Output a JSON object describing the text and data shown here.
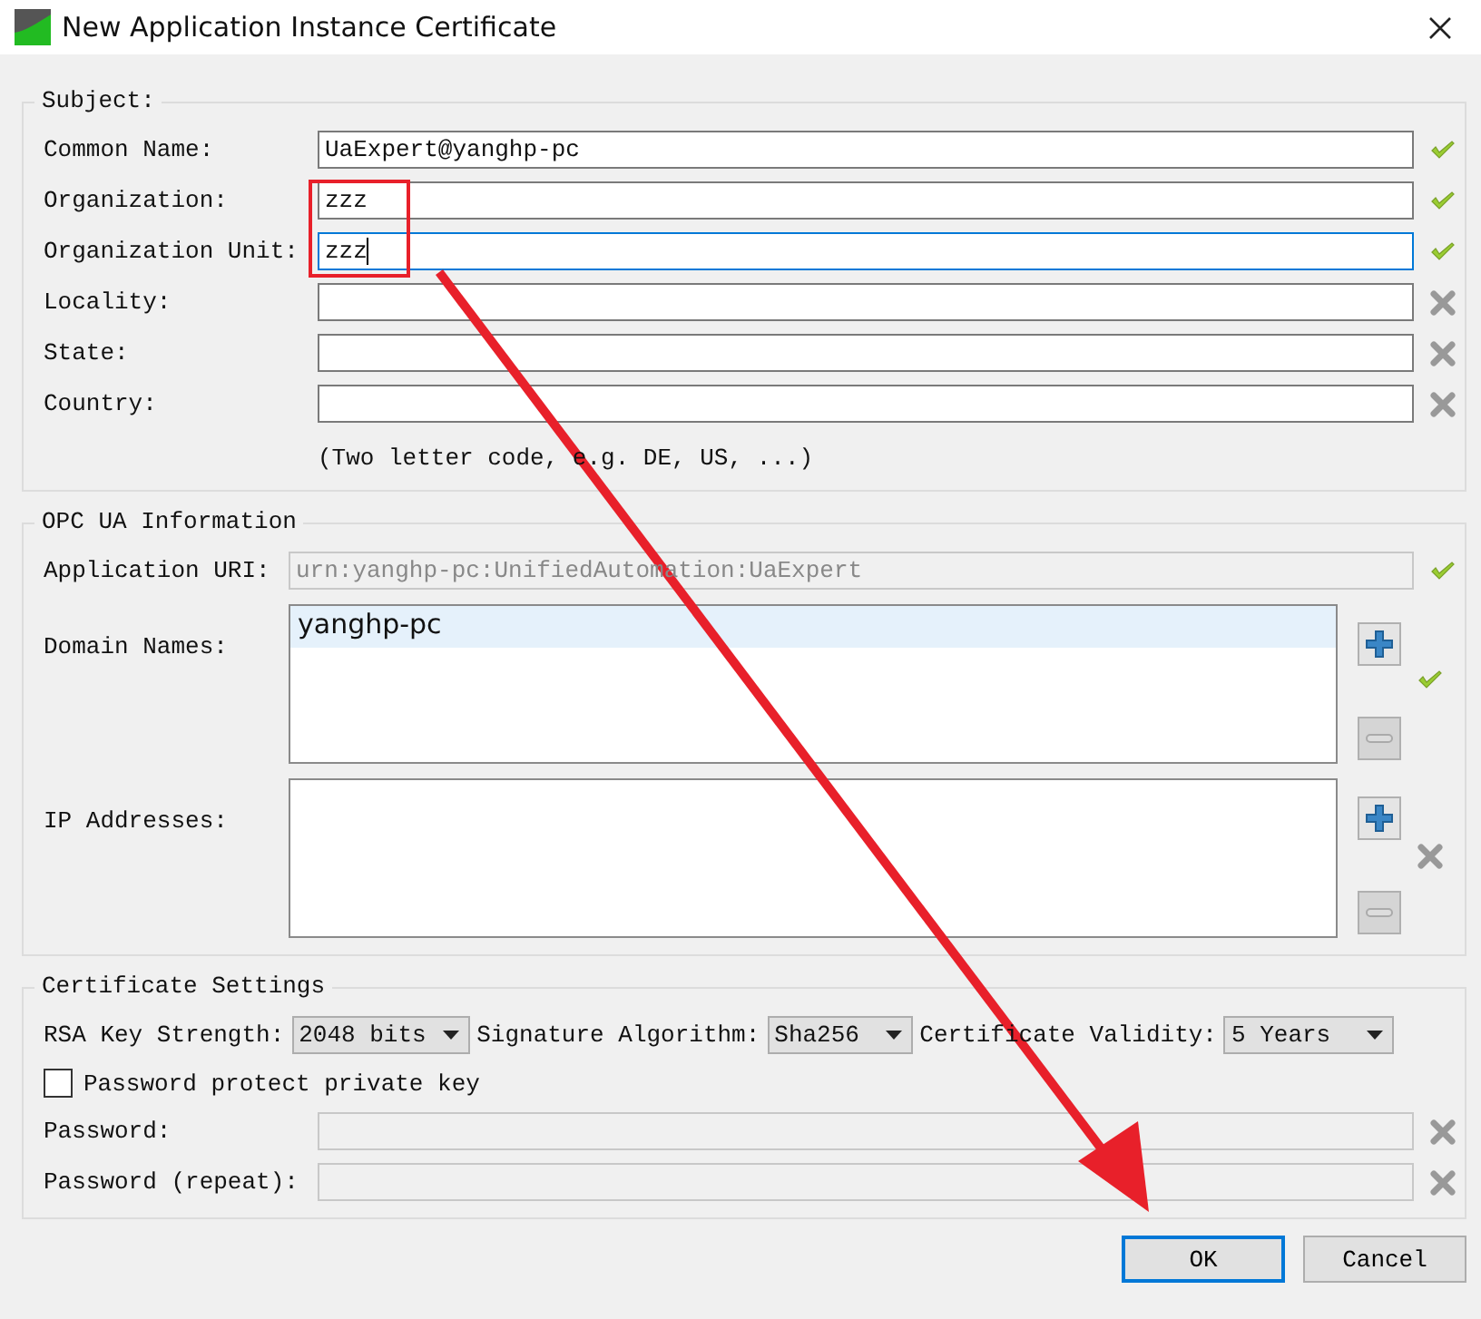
{
  "window": {
    "title": "New Application Instance Certificate"
  },
  "subject": {
    "title": "Subject:",
    "fields": [
      {
        "label": "Common Name:",
        "value": "UaExpert@yanghp-pc",
        "focused": false,
        "valid": true
      },
      {
        "label": "Organization:",
        "value": "zzz",
        "focused": false,
        "valid": true
      },
      {
        "label": "Organization Unit:",
        "value": "zzz",
        "focused": true,
        "valid": true
      },
      {
        "label": "Locality:",
        "focused": false,
        "valid": false
      },
      {
        "label": "State:",
        "focused": false,
        "valid": false
      },
      {
        "label": "Country:",
        "focused": false,
        "valid": false
      }
    ],
    "hint": "(Two letter code, e.g. DE, US, ...)"
  },
  "opc": {
    "title": "OPC UA Information",
    "application_uri": {
      "label": "Application URI:",
      "value": "urn:yanghp-pc:UnifiedAutomation:UaExpert",
      "disabled": true,
      "valid": true
    },
    "lists": [
      {
        "label": "Domain Names:",
        "valid": true,
        "items": [
          {
            "text": "yanghp-pc",
            "selected": true
          }
        ]
      },
      {
        "label": "IP Addresses:",
        "valid": false
      }
    ]
  },
  "certificate_settings": {
    "title": "Certificate Settings",
    "dropdowns": [
      {
        "label": "RSA Key Strength:",
        "value": "2048 bits"
      },
      {
        "label": "Signature Algorithm:",
        "value": "Sha256"
      },
      {
        "label": "Certificate Validity:",
        "value": "5 Years"
      }
    ],
    "checkbox": {
      "label": "Password protect private key",
      "checked": false
    },
    "passwords": [
      {
        "label": "Password:",
        "disabled": true,
        "valid": false
      },
      {
        "label": "Password (repeat):",
        "disabled": true,
        "valid": false
      }
    ]
  },
  "buttons": [
    {
      "label": "OK",
      "default": true
    },
    {
      "label": "Cancel",
      "default": false
    }
  ]
}
